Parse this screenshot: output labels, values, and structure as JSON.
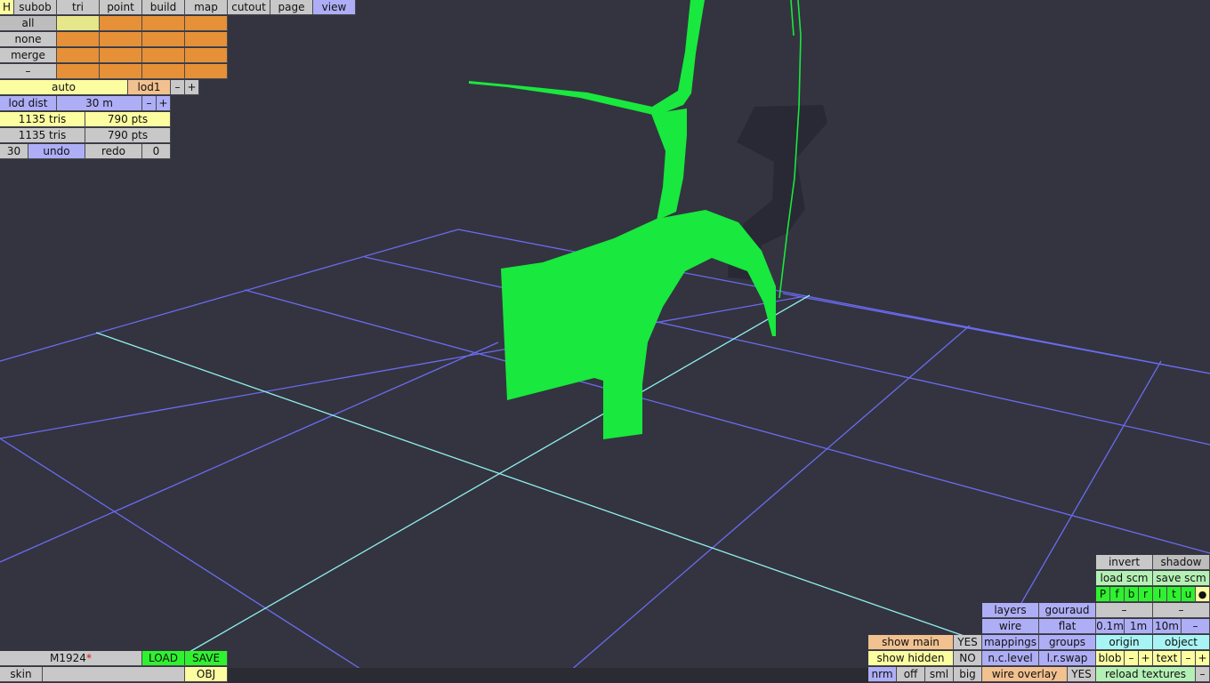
{
  "menu": {
    "h": "H",
    "subob": "subob",
    "tri": "tri",
    "point": "point",
    "build": "build",
    "map": "map",
    "cutout": "cutout",
    "page": "page",
    "view": "view"
  },
  "selection": {
    "all": "all",
    "none": "none",
    "merge": "merge",
    "minus": "–"
  },
  "lod": {
    "auto": "auto",
    "level": "lod1",
    "minus": "–",
    "plus": "+",
    "dist_label": "lod dist",
    "dist_value": "30 m",
    "dist_minus": "–",
    "dist_plus": "+"
  },
  "stats": {
    "row1_tris": "1135 tris",
    "row1_pts": "790 pts",
    "row2_tris": "1135 tris",
    "row2_pts": "790 pts"
  },
  "history": {
    "undo_count": "30",
    "undo": "undo",
    "redo": "redo",
    "redo_count": "0"
  },
  "file": {
    "name": "M1924",
    "modified_mark": "*",
    "load": "LOAD",
    "save": "SAVE",
    "skin": "skin",
    "obj": "OBJ"
  },
  "display": {
    "show_main": "show main",
    "show_main_value": "YES",
    "show_hidden": "show hidden",
    "show_hidden_value": "NO",
    "nrm": "nrm",
    "off": "off",
    "sml": "sml",
    "big": "big"
  },
  "render": {
    "layers": "layers",
    "gouraud": "gouraud",
    "wire": "wire",
    "flat": "flat",
    "mappings": "mappings",
    "groups": "groups",
    "nc_level": "n.c.level",
    "lr_swap": "l.r.swap",
    "wire_overlay": "wire overlay",
    "wire_overlay_value": "YES"
  },
  "scene": {
    "invert": "invert",
    "shadow": "shadow",
    "load_scm": "load scm",
    "save_scm": "save scm",
    "view_letters": [
      "P",
      "f",
      "b",
      "r",
      "l",
      "t",
      "u"
    ],
    "dot": "●",
    "dash_left": "–",
    "dash_right": "–",
    "grid_01": "0.1m",
    "grid_1": "1m",
    "grid_10": "10m",
    "grid_minus": "–",
    "origin": "origin",
    "object": "object",
    "blob": "blob",
    "blob_minus": "–",
    "blob_plus": "+",
    "text": "text",
    "text_minus": "–",
    "text_plus": "+",
    "reload_textures": "reload textures",
    "reload_minus": "–"
  },
  "colors": {
    "background": "#33343f",
    "grid": "#6b6bf0",
    "axis": "#8ff0f0",
    "mesh": "#19e83e",
    "shadow": "#272833"
  }
}
